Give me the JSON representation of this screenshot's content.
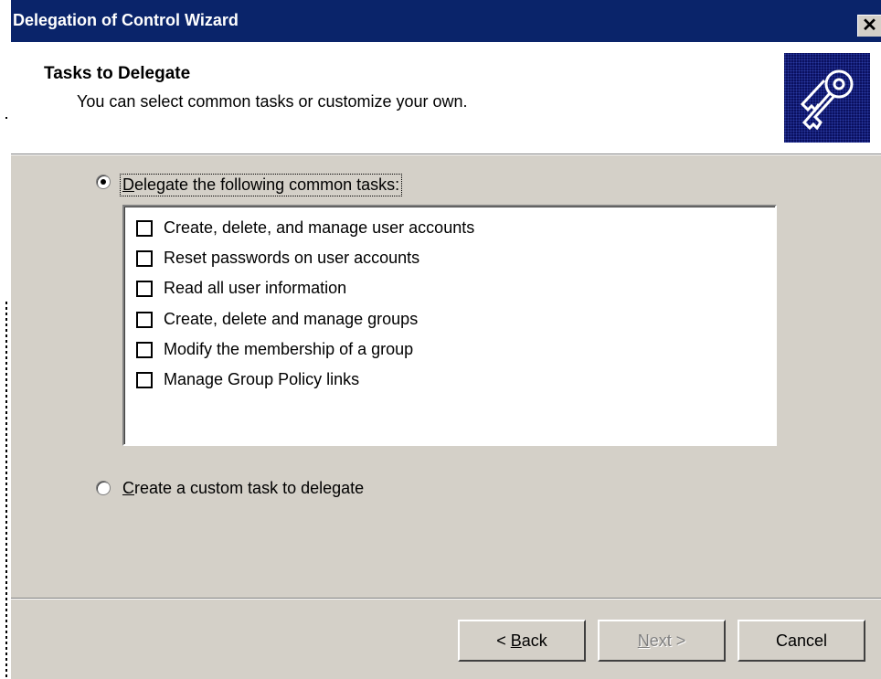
{
  "window": {
    "title": "Delegation of Control Wizard",
    "close_glyph": "✕"
  },
  "header": {
    "title": "Tasks to Delegate",
    "subtitle": "You can select common tasks or customize your own.",
    "icon": "keys-icon"
  },
  "options": {
    "common": {
      "label_mnemonic": "D",
      "label_rest": "elegate the following common tasks:",
      "checked": true
    },
    "custom": {
      "label_mnemonic": "C",
      "label_rest": "reate a custom task to delegate",
      "checked": false
    }
  },
  "tasks": [
    {
      "label": "Create, delete, and manage user accounts",
      "checked": false
    },
    {
      "label": "Reset passwords on user accounts",
      "checked": false
    },
    {
      "label": "Read all user information",
      "checked": false
    },
    {
      "label": "Create, delete and manage groups",
      "checked": false
    },
    {
      "label": "Modify the membership of a group",
      "checked": false
    },
    {
      "label": "Manage Group Policy links",
      "checked": false
    }
  ],
  "buttons": {
    "back_prefix": "< ",
    "back_mnemonic": "B",
    "back_rest": "ack",
    "next_mnemonic": "N",
    "next_rest": "ext >",
    "cancel": "Cancel"
  }
}
